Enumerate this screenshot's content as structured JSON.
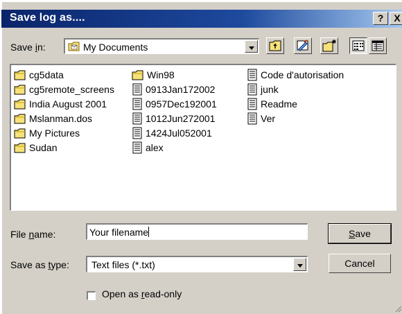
{
  "window": {
    "title": "Save log as....",
    "help_label": "?",
    "close_label": "X"
  },
  "save_in": {
    "label_pre": "Save ",
    "label_u": "i",
    "label_post": "n:",
    "value": "My Documents",
    "value_icon": "folder-documents-icon"
  },
  "toolbar": {
    "buttons": [
      {
        "name": "up-one-level-button",
        "icon": "up-folder-icon"
      },
      {
        "name": "desktop-button",
        "icon": "desktop-icon"
      },
      {
        "name": "new-folder-button",
        "icon": "new-folder-icon"
      },
      {
        "name": "list-view-button",
        "icon": "list-view-icon",
        "pressed": true
      },
      {
        "name": "details-view-button",
        "icon": "details-view-icon"
      }
    ]
  },
  "files": {
    "col1": [
      {
        "name": "cg5data",
        "type": "folder"
      },
      {
        "name": "cg5remote_screens",
        "type": "folder"
      },
      {
        "name": "India August 2001",
        "type": "folder"
      },
      {
        "name": "Mslanman.dos",
        "type": "folder"
      },
      {
        "name": "My Pictures",
        "type": "folder"
      },
      {
        "name": "Sudan",
        "type": "folder"
      }
    ],
    "col2": [
      {
        "name": "Win98",
        "type": "folder"
      },
      {
        "name": "0913Jan172002",
        "type": "file"
      },
      {
        "name": "0957Dec192001",
        "type": "file"
      },
      {
        "name": "1012Jun272001",
        "type": "file"
      },
      {
        "name": "1424Jul052001",
        "type": "file"
      },
      {
        "name": "alex",
        "type": "file"
      }
    ],
    "col3": [
      {
        "name": "Code d'autorisation",
        "type": "file"
      },
      {
        "name": "junk",
        "type": "file"
      },
      {
        "name": "Readme",
        "type": "file"
      },
      {
        "name": "Ver",
        "type": "file"
      }
    ]
  },
  "file_name": {
    "label_pre": "File ",
    "label_u": "n",
    "label_post": "ame:",
    "value": "Your filename"
  },
  "save_as_type": {
    "label_pre": "Save as ",
    "label_u": "t",
    "label_post": "ype:",
    "value": "Text files (*.txt)"
  },
  "buttons": {
    "save_u": "S",
    "save_post": "ave",
    "cancel": "Cancel"
  },
  "read_only": {
    "label_pre": "Open as ",
    "label_u": "r",
    "label_post": "ead-only",
    "checked": false
  }
}
